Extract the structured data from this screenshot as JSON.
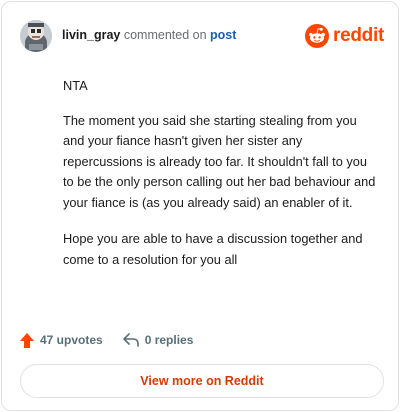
{
  "header": {
    "username": "livin_gray",
    "action_text": "commented on",
    "post_link": "post",
    "logo_text": "reddit"
  },
  "comment": {
    "paragraphs": [
      "NTA",
      "The moment you said she starting stealing from you and your fiance hasn't given her sister any repercussions is already too far. It shouldn't fall to you to be the only person calling out her bad behaviour and your fiance is (as you already said) an enabler of it.",
      "Hope you are able to have a discussion together and come to a resolution for you all"
    ]
  },
  "footer": {
    "upvotes": "47 upvotes",
    "replies": "0 replies"
  },
  "view_more_label": "View more on Reddit",
  "colors": {
    "brand": "#ff4500",
    "link": "#1a5fb4",
    "view_more": "#d93a00"
  }
}
